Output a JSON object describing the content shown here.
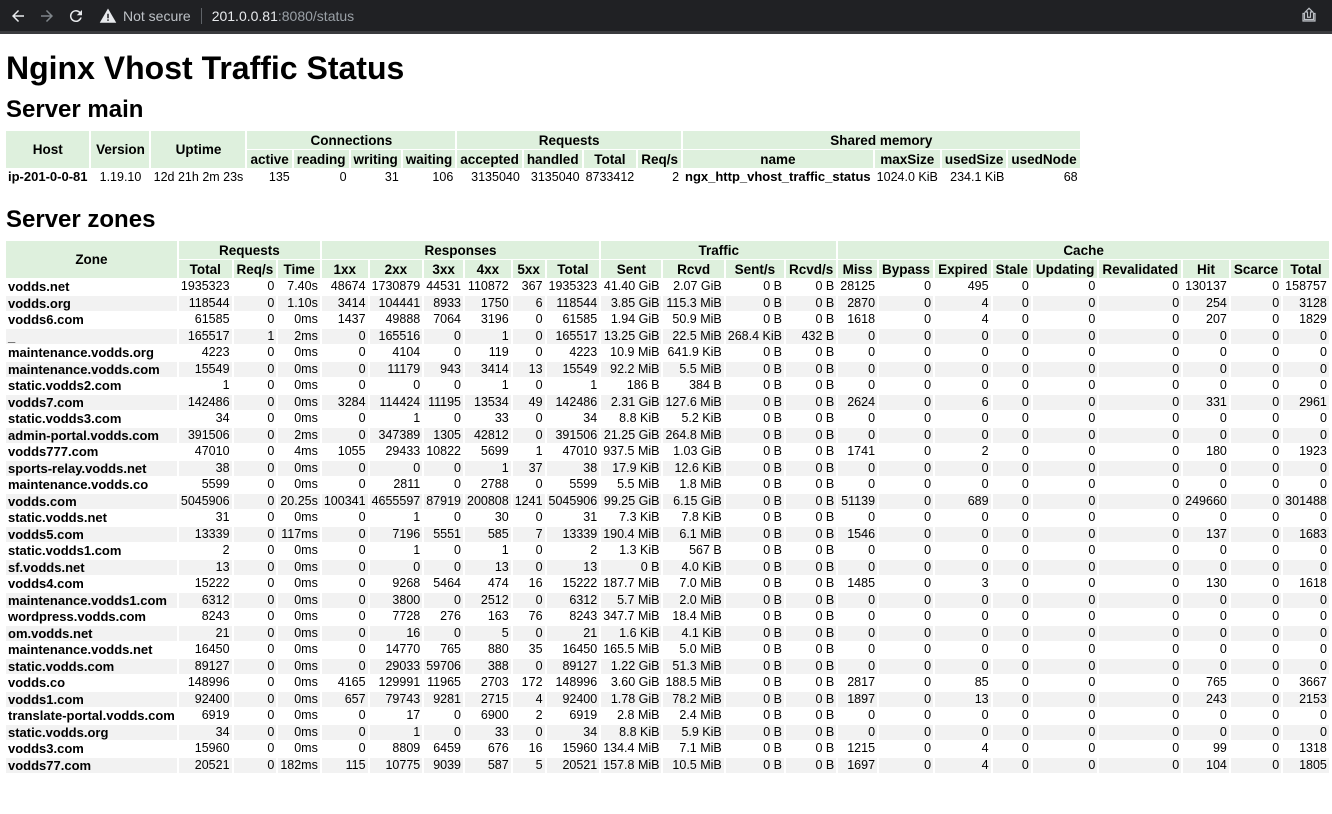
{
  "browser": {
    "security_label": "Not secure",
    "url_host": "201.0.0.81",
    "url_path": ":8080/status"
  },
  "page_title": "Nginx Vhost Traffic Status",
  "server_main": {
    "title": "Server main",
    "groups": [
      "Host",
      "Version",
      "Uptime",
      "Connections",
      "Requests",
      "Shared memory"
    ],
    "subheaders": [
      "active",
      "reading",
      "writing",
      "waiting",
      "accepted",
      "handled",
      "Total",
      "Req/s",
      "name",
      "maxSize",
      "usedSize",
      "usedNode"
    ],
    "row": [
      "ip-201-0-0-81",
      "1.19.10",
      "12d 21h 2m 23s",
      "135",
      "0",
      "31",
      "106",
      "3135040",
      "3135040",
      "8733412",
      "2",
      "ngx_http_vhost_traffic_status",
      "1024.0 KiB",
      "234.1 KiB",
      "68"
    ]
  },
  "server_zones": {
    "title": "Server zones",
    "groups": [
      "Zone",
      "Requests",
      "Responses",
      "Traffic",
      "Cache"
    ],
    "subheaders": [
      "Total",
      "Req/s",
      "Time",
      "1xx",
      "2xx",
      "3xx",
      "4xx",
      "5xx",
      "Total",
      "Sent",
      "Rcvd",
      "Sent/s",
      "Rcvd/s",
      "Miss",
      "Bypass",
      "Expired",
      "Stale",
      "Updating",
      "Revalidated",
      "Hit",
      "Scarce",
      "Total"
    ],
    "rows": [
      [
        "vodds.net",
        "1935323",
        "0",
        "7.40s",
        "48674",
        "1730879",
        "44531",
        "110872",
        "367",
        "1935323",
        "41.40 GiB",
        "2.07 GiB",
        "0 B",
        "0 B",
        "28125",
        "0",
        "495",
        "0",
        "0",
        "0",
        "130137",
        "0",
        "158757"
      ],
      [
        "vodds.org",
        "118544",
        "0",
        "1.10s",
        "3414",
        "104441",
        "8933",
        "1750",
        "6",
        "118544",
        "3.85 GiB",
        "115.3 MiB",
        "0 B",
        "0 B",
        "2870",
        "0",
        "4",
        "0",
        "0",
        "0",
        "254",
        "0",
        "3128"
      ],
      [
        "vodds6.com",
        "61585",
        "0",
        "0ms",
        "1437",
        "49888",
        "7064",
        "3196",
        "0",
        "61585",
        "1.94 GiB",
        "50.9 MiB",
        "0 B",
        "0 B",
        "1618",
        "0",
        "4",
        "0",
        "0",
        "0",
        "207",
        "0",
        "1829"
      ],
      [
        "_",
        "165517",
        "1",
        "2ms",
        "0",
        "165516",
        "0",
        "1",
        "0",
        "165517",
        "13.25 GiB",
        "22.5 MiB",
        "268.4 KiB",
        "432 B",
        "0",
        "0",
        "0",
        "0",
        "0",
        "0",
        "0",
        "0",
        "0"
      ],
      [
        "maintenance.vodds.org",
        "4223",
        "0",
        "0ms",
        "0",
        "4104",
        "0",
        "119",
        "0",
        "4223",
        "10.9 MiB",
        "641.9 KiB",
        "0 B",
        "0 B",
        "0",
        "0",
        "0",
        "0",
        "0",
        "0",
        "0",
        "0",
        "0"
      ],
      [
        "maintenance.vodds.com",
        "15549",
        "0",
        "0ms",
        "0",
        "11179",
        "943",
        "3414",
        "13",
        "15549",
        "92.2 MiB",
        "5.5 MiB",
        "0 B",
        "0 B",
        "0",
        "0",
        "0",
        "0",
        "0",
        "0",
        "0",
        "0",
        "0"
      ],
      [
        "static.vodds2.com",
        "1",
        "0",
        "0ms",
        "0",
        "0",
        "0",
        "1",
        "0",
        "1",
        "186 B",
        "384 B",
        "0 B",
        "0 B",
        "0",
        "0",
        "0",
        "0",
        "0",
        "0",
        "0",
        "0",
        "0"
      ],
      [
        "vodds7.com",
        "142486",
        "0",
        "0ms",
        "3284",
        "114424",
        "11195",
        "13534",
        "49",
        "142486",
        "2.31 GiB",
        "127.6 MiB",
        "0 B",
        "0 B",
        "2624",
        "0",
        "6",
        "0",
        "0",
        "0",
        "331",
        "0",
        "2961"
      ],
      [
        "static.vodds3.com",
        "34",
        "0",
        "0ms",
        "0",
        "1",
        "0",
        "33",
        "0",
        "34",
        "8.8 KiB",
        "5.2 KiB",
        "0 B",
        "0 B",
        "0",
        "0",
        "0",
        "0",
        "0",
        "0",
        "0",
        "0",
        "0"
      ],
      [
        "admin-portal.vodds.com",
        "391506",
        "0",
        "2ms",
        "0",
        "347389",
        "1305",
        "42812",
        "0",
        "391506",
        "21.25 GiB",
        "264.8 MiB",
        "0 B",
        "0 B",
        "0",
        "0",
        "0",
        "0",
        "0",
        "0",
        "0",
        "0",
        "0"
      ],
      [
        "vodds777.com",
        "47010",
        "0",
        "4ms",
        "1055",
        "29433",
        "10822",
        "5699",
        "1",
        "47010",
        "937.5 MiB",
        "1.03 GiB",
        "0 B",
        "0 B",
        "1741",
        "0",
        "2",
        "0",
        "0",
        "0",
        "180",
        "0",
        "1923"
      ],
      [
        "sports-relay.vodds.net",
        "38",
        "0",
        "0ms",
        "0",
        "0",
        "0",
        "1",
        "37",
        "38",
        "17.9 KiB",
        "12.6 KiB",
        "0 B",
        "0 B",
        "0",
        "0",
        "0",
        "0",
        "0",
        "0",
        "0",
        "0",
        "0"
      ],
      [
        "maintenance.vodds.co",
        "5599",
        "0",
        "0ms",
        "0",
        "2811",
        "0",
        "2788",
        "0",
        "5599",
        "5.5 MiB",
        "1.8 MiB",
        "0 B",
        "0 B",
        "0",
        "0",
        "0",
        "0",
        "0",
        "0",
        "0",
        "0",
        "0"
      ],
      [
        "vodds.com",
        "5045906",
        "0",
        "20.25s",
        "100341",
        "4655597",
        "87919",
        "200808",
        "1241",
        "5045906",
        "99.25 GiB",
        "6.15 GiB",
        "0 B",
        "0 B",
        "51139",
        "0",
        "689",
        "0",
        "0",
        "0",
        "249660",
        "0",
        "301488"
      ],
      [
        "static.vodds.net",
        "31",
        "0",
        "0ms",
        "0",
        "1",
        "0",
        "30",
        "0",
        "31",
        "7.3 KiB",
        "7.8 KiB",
        "0 B",
        "0 B",
        "0",
        "0",
        "0",
        "0",
        "0",
        "0",
        "0",
        "0",
        "0"
      ],
      [
        "vodds5.com",
        "13339",
        "0",
        "117ms",
        "0",
        "7196",
        "5551",
        "585",
        "7",
        "13339",
        "190.4 MiB",
        "6.1 MiB",
        "0 B",
        "0 B",
        "1546",
        "0",
        "0",
        "0",
        "0",
        "0",
        "137",
        "0",
        "1683"
      ],
      [
        "static.vodds1.com",
        "2",
        "0",
        "0ms",
        "0",
        "1",
        "0",
        "1",
        "0",
        "2",
        "1.3 KiB",
        "567 B",
        "0 B",
        "0 B",
        "0",
        "0",
        "0",
        "0",
        "0",
        "0",
        "0",
        "0",
        "0"
      ],
      [
        "sf.vodds.net",
        "13",
        "0",
        "0ms",
        "0",
        "0",
        "0",
        "13",
        "0",
        "13",
        "0 B",
        "4.0 KiB",
        "0 B",
        "0 B",
        "0",
        "0",
        "0",
        "0",
        "0",
        "0",
        "0",
        "0",
        "0"
      ],
      [
        "vodds4.com",
        "15222",
        "0",
        "0ms",
        "0",
        "9268",
        "5464",
        "474",
        "16",
        "15222",
        "187.7 MiB",
        "7.0 MiB",
        "0 B",
        "0 B",
        "1485",
        "0",
        "3",
        "0",
        "0",
        "0",
        "130",
        "0",
        "1618"
      ],
      [
        "maintenance.vodds1.com",
        "6312",
        "0",
        "0ms",
        "0",
        "3800",
        "0",
        "2512",
        "0",
        "6312",
        "5.7 MiB",
        "2.0 MiB",
        "0 B",
        "0 B",
        "0",
        "0",
        "0",
        "0",
        "0",
        "0",
        "0",
        "0",
        "0"
      ],
      [
        "wordpress.vodds.com",
        "8243",
        "0",
        "0ms",
        "0",
        "7728",
        "276",
        "163",
        "76",
        "8243",
        "347.7 MiB",
        "18.4 MiB",
        "0 B",
        "0 B",
        "0",
        "0",
        "0",
        "0",
        "0",
        "0",
        "0",
        "0",
        "0"
      ],
      [
        "om.vodds.net",
        "21",
        "0",
        "0ms",
        "0",
        "16",
        "0",
        "5",
        "0",
        "21",
        "1.6 KiB",
        "4.1 KiB",
        "0 B",
        "0 B",
        "0",
        "0",
        "0",
        "0",
        "0",
        "0",
        "0",
        "0",
        "0"
      ],
      [
        "maintenance.vodds.net",
        "16450",
        "0",
        "0ms",
        "0",
        "14770",
        "765",
        "880",
        "35",
        "16450",
        "165.5 MiB",
        "5.0 MiB",
        "0 B",
        "0 B",
        "0",
        "0",
        "0",
        "0",
        "0",
        "0",
        "0",
        "0",
        "0"
      ],
      [
        "static.vodds.com",
        "89127",
        "0",
        "0ms",
        "0",
        "29033",
        "59706",
        "388",
        "0",
        "89127",
        "1.22 GiB",
        "51.3 MiB",
        "0 B",
        "0 B",
        "0",
        "0",
        "0",
        "0",
        "0",
        "0",
        "0",
        "0",
        "0"
      ],
      [
        "vodds.co",
        "148996",
        "0",
        "0ms",
        "4165",
        "129991",
        "11965",
        "2703",
        "172",
        "148996",
        "3.60 GiB",
        "188.5 MiB",
        "0 B",
        "0 B",
        "2817",
        "0",
        "85",
        "0",
        "0",
        "0",
        "765",
        "0",
        "3667"
      ],
      [
        "vodds1.com",
        "92400",
        "0",
        "0ms",
        "657",
        "79743",
        "9281",
        "2715",
        "4",
        "92400",
        "1.78 GiB",
        "78.2 MiB",
        "0 B",
        "0 B",
        "1897",
        "0",
        "13",
        "0",
        "0",
        "0",
        "243",
        "0",
        "2153"
      ],
      [
        "translate-portal.vodds.com",
        "6919",
        "0",
        "0ms",
        "0",
        "17",
        "0",
        "6900",
        "2",
        "6919",
        "2.8 MiB",
        "2.4 MiB",
        "0 B",
        "0 B",
        "0",
        "0",
        "0",
        "0",
        "0",
        "0",
        "0",
        "0",
        "0"
      ],
      [
        "static.vodds.org",
        "34",
        "0",
        "0ms",
        "0",
        "1",
        "0",
        "33",
        "0",
        "34",
        "8.8 KiB",
        "5.9 KiB",
        "0 B",
        "0 B",
        "0",
        "0",
        "0",
        "0",
        "0",
        "0",
        "0",
        "0",
        "0"
      ],
      [
        "vodds3.com",
        "15960",
        "0",
        "0ms",
        "0",
        "8809",
        "6459",
        "676",
        "16",
        "15960",
        "134.4 MiB",
        "7.1 MiB",
        "0 B",
        "0 B",
        "1215",
        "0",
        "4",
        "0",
        "0",
        "0",
        "99",
        "0",
        "1318"
      ],
      [
        "vodds77.com",
        "20521",
        "0",
        "182ms",
        "115",
        "10775",
        "9039",
        "587",
        "5",
        "20521",
        "157.8 MiB",
        "10.5 MiB",
        "0 B",
        "0 B",
        "1697",
        "0",
        "4",
        "0",
        "0",
        "0",
        "104",
        "0",
        "1805"
      ]
    ]
  }
}
